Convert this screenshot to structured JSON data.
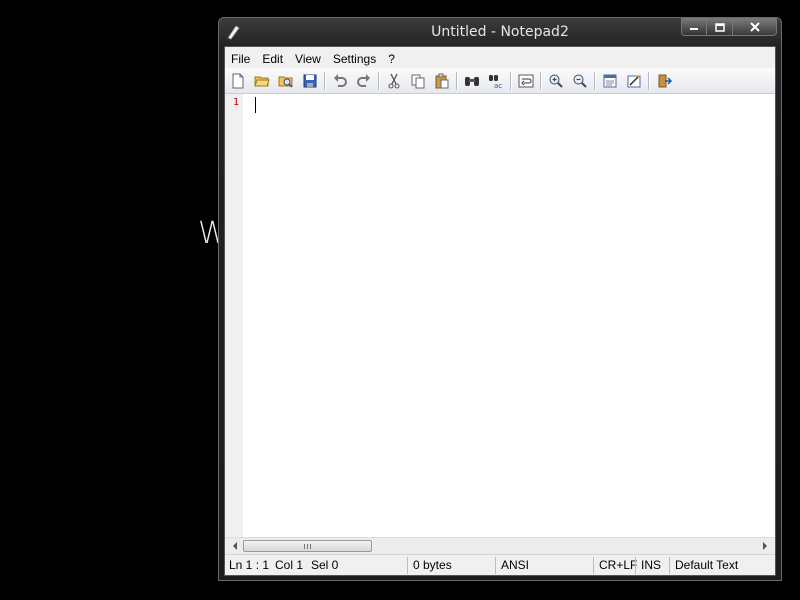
{
  "background": {
    "partial_text": "W"
  },
  "window": {
    "title": "Untitled - Notepad2",
    "app_icon": "notepad2-icon",
    "caption_buttons": [
      "minimize-icon",
      "maximize-icon",
      "close-icon"
    ]
  },
  "menu": {
    "items": [
      {
        "label": "File"
      },
      {
        "label": "Edit"
      },
      {
        "label": "View"
      },
      {
        "label": "Settings"
      },
      {
        "label": "?"
      }
    ]
  },
  "toolbar": {
    "buttons": [
      "new-file-icon",
      "open-folder-icon",
      "browse-icon",
      "save-icon",
      "undo-icon",
      "redo-icon",
      "cut-icon",
      "copy-icon",
      "paste-icon",
      "find-icon",
      "replace-icon",
      "word-wrap-icon",
      "zoom-in-icon",
      "zoom-out-icon",
      "scheme-icon",
      "customize-scheme-icon",
      "exit-icon"
    ]
  },
  "editor": {
    "line_numbers": [
      "1"
    ],
    "content": ""
  },
  "status": {
    "position": "Ln 1 : 1",
    "col": "Col 1",
    "sel": "Sel 0",
    "size": "0 bytes",
    "encoding": "ANSI",
    "eol": "CR+LF",
    "mode": "INS",
    "scheme": "Default Text"
  },
  "colors": {
    "line_number": "#c00000",
    "desktop": "#000000"
  }
}
